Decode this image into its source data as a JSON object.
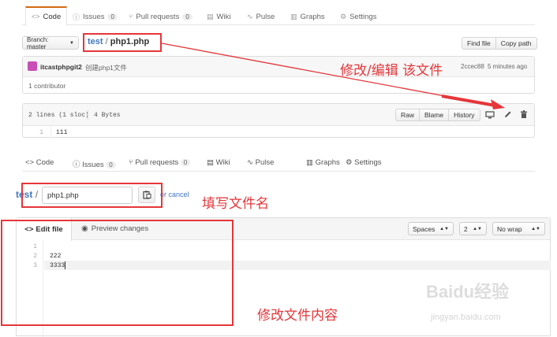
{
  "tabs": [
    {
      "label": "Code",
      "icon": "code-icon"
    },
    {
      "label": "Issues",
      "count": "0",
      "icon": "issue-icon"
    },
    {
      "label": "Pull requests",
      "count": "0",
      "icon": "pull-request-icon"
    },
    {
      "label": "Wiki",
      "icon": "book-icon"
    },
    {
      "label": "Pulse",
      "icon": "pulse-icon"
    },
    {
      "label": "Graphs",
      "icon": "graph-icon"
    },
    {
      "label": "Settings",
      "icon": "gear-icon"
    }
  ],
  "file_view": {
    "branch_label": "Branch: master",
    "repo": "test",
    "separator": "/",
    "filename": "php1.php",
    "find_file": "Find file",
    "copy_path": "Copy path",
    "commit_author": "itcastphpgit2",
    "commit_message": "创建php1文件",
    "commit_sha": "2ccec88",
    "commit_time": "5 minutes ago",
    "contributors": "1 contributor",
    "file_meta": "2 lines (1 sloc)",
    "file_size": "4 Bytes",
    "raw": "Raw",
    "blame": "Blame",
    "history": "History",
    "lines": [
      {
        "n": "1",
        "text": "111"
      }
    ]
  },
  "edit_view": {
    "repo": "test",
    "separator": "/",
    "filename_value": "php1.php",
    "cancel_text": "or cancel",
    "edit_tab": "Edit file",
    "preview_tab": "Preview changes",
    "indent_mode": "Spaces",
    "indent_size": "2",
    "wrap_mode": "No wrap",
    "lines": [
      {
        "n": "1",
        "text": ""
      },
      {
        "n": "2",
        "text": "222"
      },
      {
        "n": "3",
        "text": "3333"
      }
    ]
  },
  "annotations": {
    "edit_file": "修改/编辑  该文件",
    "fill_name": "填写文件名",
    "edit_content": "修改文件内容"
  },
  "watermark": {
    "brand": "Baidu经验",
    "url": "jingyan.baidu.com"
  },
  "colors": {
    "annotation_red": "#e5363a",
    "link_blue": "#4078c0",
    "active_tab_orange": "#d26911"
  }
}
